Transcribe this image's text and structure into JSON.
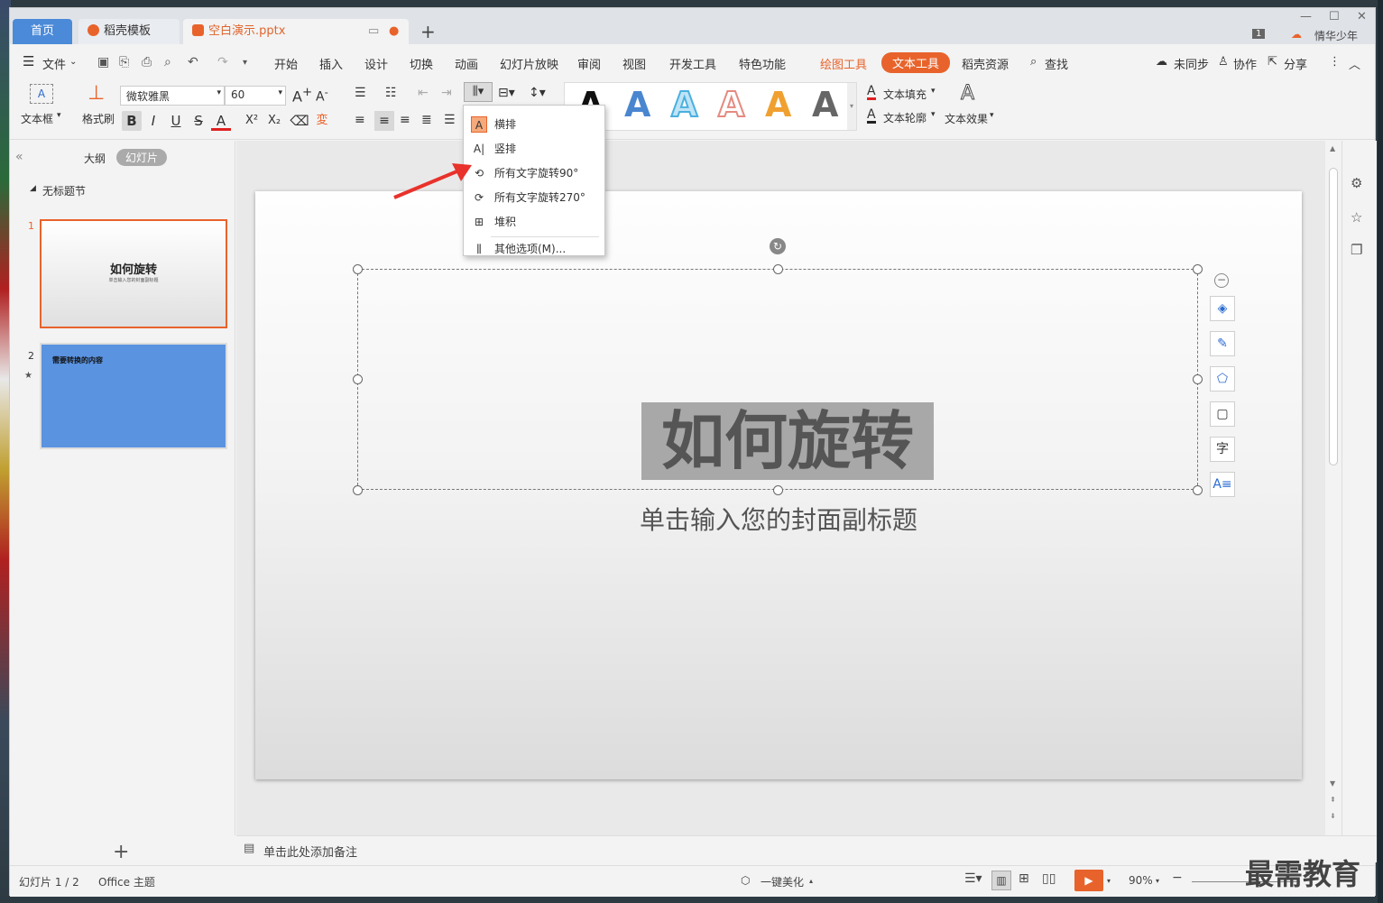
{
  "tabs": {
    "home": "首页",
    "template": "稻壳模板",
    "document": "空白演示.pptx"
  },
  "user": {
    "badge": "1",
    "name": "情华少年"
  },
  "menu": {
    "file": "文件",
    "items": [
      "开始",
      "插入",
      "设计",
      "切换",
      "动画",
      "幻灯片放映",
      "审阅",
      "视图",
      "开发工具",
      "特色功能"
    ],
    "drawing_tools": "绘图工具",
    "text_tools": "文本工具",
    "docer_resources": "稻壳资源",
    "search": "查找",
    "unsynced": "未同步",
    "collab": "协作",
    "share": "分享"
  },
  "ribbon": {
    "textbox": "文本框",
    "format_painter": "格式刷",
    "font_name": "微软雅黑",
    "font_size": "60",
    "text_fill": "文本填充",
    "text_outline": "文本轮廓",
    "text_effect": "文本效果",
    "gallery_letter": "A"
  },
  "text_direction_menu": {
    "items": [
      "横排",
      "竖排",
      "所有文字旋转90°",
      "所有文字旋转270°",
      "堆积",
      "其他选项(M)..."
    ]
  },
  "left_panel": {
    "tab_outline": "大纲",
    "tab_slides": "幻灯片",
    "section": "无标题节",
    "slides": [
      {
        "num": "1",
        "title": "如何旋转",
        "subtitle": "单击输入您的封面副标题"
      },
      {
        "num": "2",
        "title": "需要转换的内容"
      }
    ]
  },
  "slide": {
    "title": "如何旋转",
    "subtitle": "单击输入您的封面副标题"
  },
  "notes": {
    "placeholder": "单击此处添加备注"
  },
  "status": {
    "slide_count": "幻灯片 1 / 2",
    "theme": "Office 主题",
    "beautify": "一键美化",
    "zoom": "90%"
  },
  "watermark": "最需教育",
  "colors": {
    "accent": "#e8632b",
    "home_tab": "#4a8ad8",
    "slide2_bg": "#5a93e0"
  }
}
